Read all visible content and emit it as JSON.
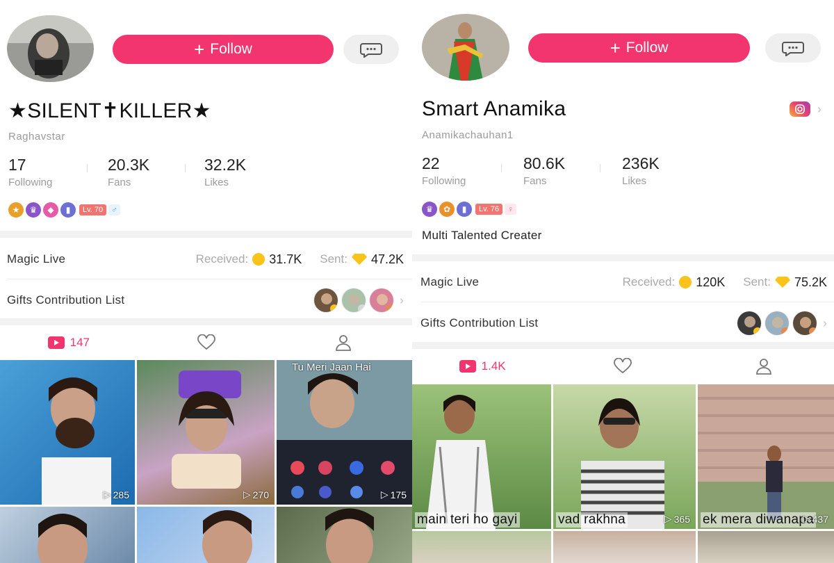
{
  "profiles": [
    {
      "follow_label": "Follow",
      "name": "★SILENT✝KILLER★",
      "handle": "Raghavstar",
      "stats": [
        {
          "value": "17",
          "label": "Following"
        },
        {
          "value": "20.3K",
          "label": "Fans"
        },
        {
          "value": "32.2K",
          "label": "Likes"
        }
      ],
      "level": "Lv. 70",
      "gender": "♂",
      "magic_live": {
        "label": "Magic Live",
        "received_label": "Received:",
        "received": "31.7K",
        "sent_label": "Sent:",
        "sent": "47.2K"
      },
      "gifts_label": "Gifts Contribution List",
      "video_count": "147",
      "videos": [
        {
          "views": "285",
          "overlay_text": ""
        },
        {
          "views": "270",
          "overlay_text": ""
        },
        {
          "views": "175",
          "overlay_text": "Tu Meri Jaan Hai"
        },
        {
          "views": "",
          "overlay_text": ""
        },
        {
          "views": "",
          "overlay_text": ""
        },
        {
          "views": "",
          "overlay_text": ""
        }
      ]
    },
    {
      "follow_label": "Follow",
      "name": "Smart Anamika",
      "handle": "Anamikachauhan1",
      "stats": [
        {
          "value": "22",
          "label": "Following"
        },
        {
          "value": "80.6K",
          "label": "Fans"
        },
        {
          "value": "236K",
          "label": "Likes"
        }
      ],
      "level": "Lv. 76",
      "gender": "♀",
      "bio": "Multi Talented Creater",
      "magic_live": {
        "label": "Magic Live",
        "received_label": "Received:",
        "received": "120K",
        "sent_label": "Sent:",
        "sent": "75.2K"
      },
      "gifts_label": "Gifts Contribution List",
      "video_count": "1.4K",
      "videos": [
        {
          "views": "",
          "caption": "main teri ho gayi"
        },
        {
          "views": "365",
          "caption": "vad rakhna"
        },
        {
          "views": "437",
          "caption": "ek mera diwanapa"
        },
        {
          "views": "",
          "caption": ""
        },
        {
          "views": "",
          "caption": ""
        },
        {
          "views": "",
          "caption": ""
        }
      ]
    }
  ],
  "colors": {
    "accent": "#f2346f",
    "gold": "#f9c31a"
  },
  "icons": [
    "plus-icon",
    "chat-bubble-icon",
    "instagram-icon",
    "video-icon",
    "heart-outline-icon",
    "user-outline-icon",
    "play-icon",
    "coin-icon",
    "diamond-icon",
    "chevron-right-icon"
  ]
}
